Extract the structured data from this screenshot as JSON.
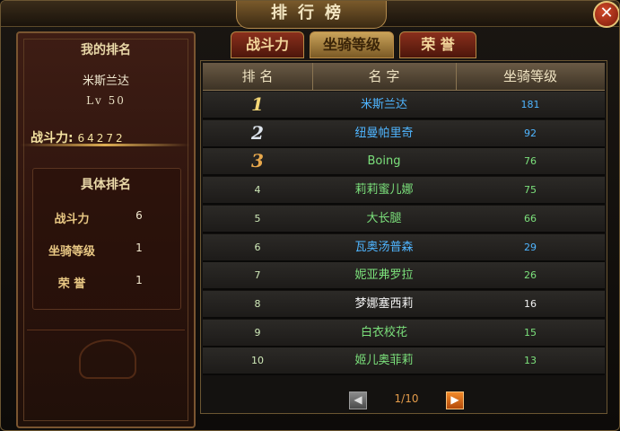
{
  "window": {
    "title": "排行榜",
    "close_icon": "close-icon"
  },
  "my_rank": {
    "title": "我的排名",
    "name": "米斯兰达",
    "level": "Lv 50",
    "power_label": "战斗力:",
    "power_value": "64272",
    "detail_title": "具体排名",
    "details": [
      {
        "label": "战斗力",
        "value": "6"
      },
      {
        "label": "坐骑等级",
        "value": "1"
      },
      {
        "label": "荣 誉",
        "value": "1"
      }
    ]
  },
  "tabs": [
    {
      "label": "战斗力",
      "active": false
    },
    {
      "label": "坐骑等级",
      "active": true
    },
    {
      "label": "荣 誉",
      "active": false
    }
  ],
  "table": {
    "headers": [
      "排 名",
      "名 字",
      "坐骑等级"
    ],
    "rows": [
      {
        "rank": "1",
        "name": "米斯兰达",
        "level": "181",
        "name_color": "#4fb5ff",
        "level_color": "#4fb5ff"
      },
      {
        "rank": "2",
        "name": "纽曼帕里奇",
        "level": "92",
        "name_color": "#4fb5ff",
        "level_color": "#4fb5ff"
      },
      {
        "rank": "3",
        "name": "Boing",
        "level": "76",
        "name_color": "#7be07b",
        "level_color": "#7be07b"
      },
      {
        "rank": "4",
        "name": "莉莉蜜儿娜",
        "level": "75",
        "name_color": "#7be07b",
        "level_color": "#7be07b"
      },
      {
        "rank": "5",
        "name": "大长腿",
        "level": "66",
        "name_color": "#7be07b",
        "level_color": "#7be07b"
      },
      {
        "rank": "6",
        "name": "瓦奥汤普森",
        "level": "29",
        "name_color": "#4fb5ff",
        "level_color": "#4fb5ff"
      },
      {
        "rank": "7",
        "name": "妮亚弗罗拉",
        "level": "26",
        "name_color": "#7be07b",
        "level_color": "#7be07b"
      },
      {
        "rank": "8",
        "name": "梦娜塞西莉",
        "level": "16",
        "name_color": "#f2f2f2",
        "level_color": "#f2f2f2"
      },
      {
        "rank": "9",
        "name": "白衣校花",
        "level": "15",
        "name_color": "#7be07b",
        "level_color": "#7be07b"
      },
      {
        "rank": "10",
        "name": "姬儿奥菲莉",
        "level": "13",
        "name_color": "#7be07b",
        "level_color": "#7be07b"
      }
    ]
  },
  "pager": {
    "text": "1/10",
    "prev_icon": "arrow-left-icon",
    "next_icon": "arrow-right-icon"
  }
}
